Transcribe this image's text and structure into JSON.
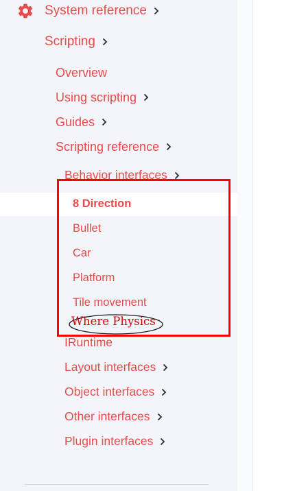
{
  "nav": {
    "system_reference": "System reference",
    "scripting": "Scripting",
    "overview": "Overview",
    "using_scripting": "Using scripting",
    "guides": "Guides",
    "scripting_reference": "Scripting reference",
    "behavior_interfaces": "Behavior interfaces",
    "behaviors": [
      "8 Direction",
      "Bullet",
      "Car",
      "Platform",
      "Tile movement"
    ],
    "iruntime": "IRuntime",
    "layout_interfaces": "Layout interfaces",
    "object_interfaces": "Object interfaces",
    "other_interfaces": "Other interfaces",
    "plugin_interfaces": "Plugin interfaces"
  },
  "annotation": {
    "handwritten_note": "Where Physics"
  },
  "colors": {
    "link": "#e94a4a",
    "sidebar_bg": "#f3f5fa",
    "active_bg": "#ffffff",
    "highlight_border": "#ff0000",
    "annotation_text": "#d40000"
  },
  "icons": {
    "section": "gear-icon",
    "expand": "chevron-right-icon"
  }
}
